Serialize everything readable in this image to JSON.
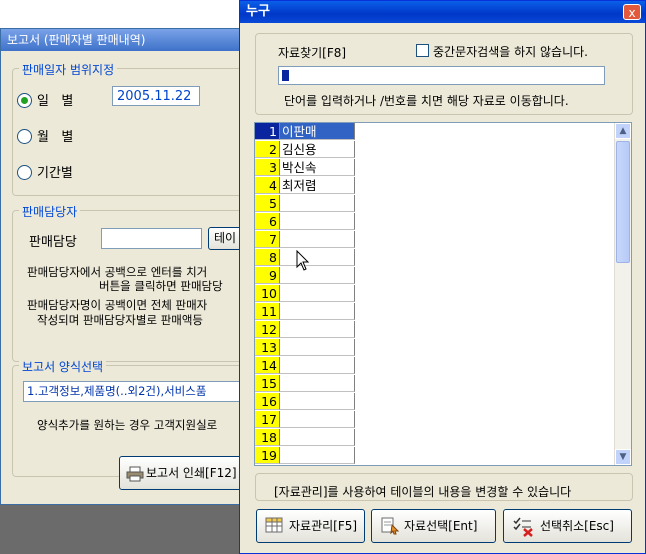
{
  "report_window": {
    "title": "보고서 (판매자별 판매내역)",
    "period": {
      "legend": "판매일자 범위지정",
      "options": [
        {
          "label": "일   별",
          "selected": true
        },
        {
          "label": "월   별",
          "selected": false
        },
        {
          "label": "기간별",
          "selected": false
        }
      ],
      "date_value": "2005.11.22"
    },
    "seller": {
      "legend": "판매담당자",
      "field_label": "판매담당",
      "button_label": "테이",
      "help_lines": [
        "판매담당자에서 공백으로 엔터를 치거",
        "버튼을 클릭하면 판매담당",
        "판매담당자명이 공백이면 전체 판매자",
        "작성되며 판매담당자별로 판매액등"
      ]
    },
    "form": {
      "legend": "보고서 양식선택",
      "selected": "1.고객정보,제품명(..외2건),서비스품",
      "help": "양식추가를 원하는 경우 고객지원실로"
    },
    "print_button": "보고서 인쇄[F12]"
  },
  "dialog": {
    "title": "누구",
    "close_label": "x",
    "search_label": "자료찾기[F8]",
    "checkbox_label": "중간문자검색을 하지 않습니다.",
    "hint": "단어를 입력하거나  /번호를 치면 해당 자료로 이동합니다.",
    "rows": [
      {
        "n": "1",
        "name": "이판매"
      },
      {
        "n": "2",
        "name": "김신용"
      },
      {
        "n": "3",
        "name": "박신속"
      },
      {
        "n": "4",
        "name": "최저렴"
      },
      {
        "n": "5",
        "name": ""
      },
      {
        "n": "6",
        "name": ""
      },
      {
        "n": "7",
        "name": ""
      },
      {
        "n": "8",
        "name": ""
      },
      {
        "n": "9",
        "name": ""
      },
      {
        "n": "10",
        "name": ""
      },
      {
        "n": "11",
        "name": ""
      },
      {
        "n": "12",
        "name": ""
      },
      {
        "n": "13",
        "name": ""
      },
      {
        "n": "14",
        "name": ""
      },
      {
        "n": "15",
        "name": ""
      },
      {
        "n": "16",
        "name": ""
      },
      {
        "n": "17",
        "name": ""
      },
      {
        "n": "18",
        "name": ""
      },
      {
        "n": "19",
        "name": ""
      }
    ],
    "note": "[자료관리]를 사용하여 테이블의 내용을 변경할 수 있습니다",
    "buttons": {
      "manage": "자료관리[F5]",
      "select": "자료선택[Ent]",
      "cancel": "선택취소[Esc]"
    }
  }
}
